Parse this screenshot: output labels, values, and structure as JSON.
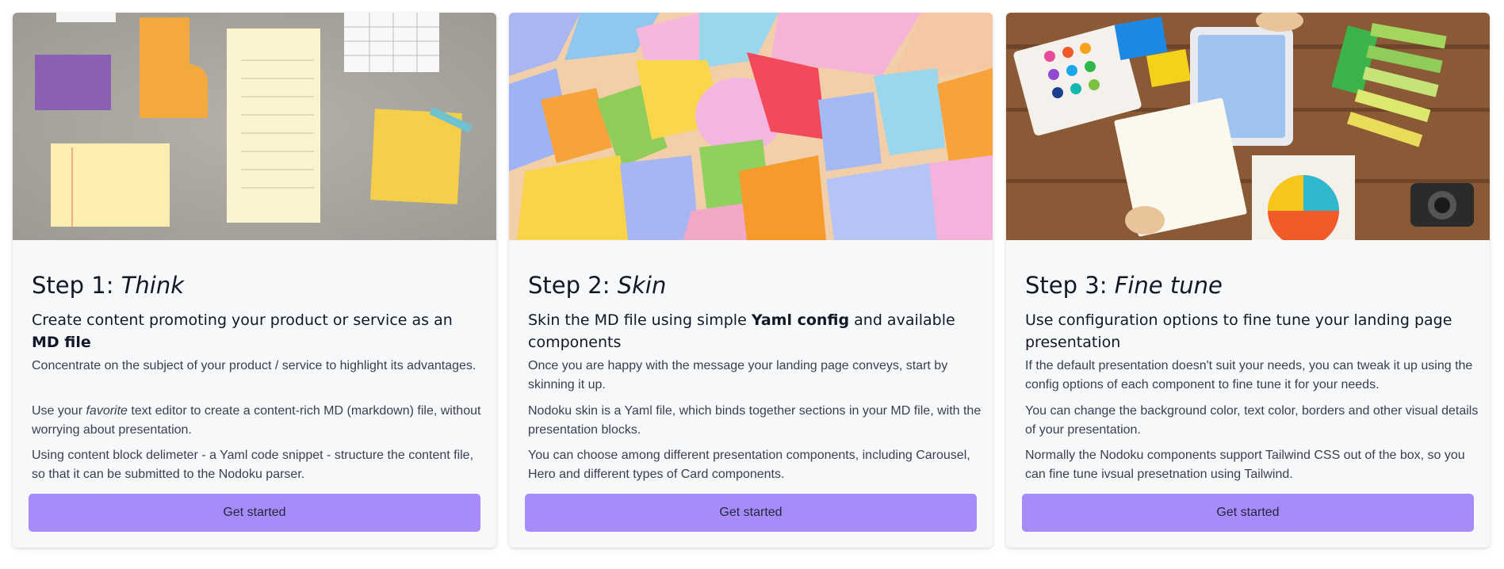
{
  "cards": [
    {
      "step_prefix": "Step 1: ",
      "step_name": "Think",
      "heading_before": "Create content promoting your product or service as an ",
      "heading_bold": "MD file",
      "heading_after": "",
      "p1": "Concentrate on the subject of your product / service to highlight its advantages.",
      "p2_before": "Use your ",
      "p2_em": "favorite",
      "p2_after": " text editor to create a content-rich MD (markdown) file, without worrying about presentation.",
      "p3": "Using content block delimeter - a Yaml code snippet - structure the content file, so that it can be submitted to the Nodoku parser.",
      "button": "Get started"
    },
    {
      "step_prefix": "Step 2: ",
      "step_name": "Skin",
      "heading_before": "Skin the MD file using simple ",
      "heading_bold": "Yaml config",
      "heading_after": " and available components",
      "p1": "Once you are happy with the message your landing page conveys, start by skinning it up.",
      "p2": "Nodoku skin is a Yaml file, which binds together sections in your MD file, with the presentation blocks.",
      "p3": "You can choose among different presentation components, including Carousel, Hero and different types of Card components.",
      "button": "Get started"
    },
    {
      "step_prefix": "Step 3: ",
      "step_name": "Fine tune",
      "heading_before": "Use configuration options to fine tune your landing page presentation",
      "p1": "If the default presentation doesn't suit your needs, you can tweak it up using the config options of each component to fine tune it for your needs.",
      "p2": "You can change the background color, text color, borders and other visual details of your presentation.",
      "p3": "Normally the Nodoku components support Tailwind CSS out of the box, so you can fine tune ivsual presetnation using Tailwind.",
      "button": "Get started"
    }
  ],
  "colors": {
    "button": "#a78bfa",
    "card_bg": "#f7f8fa",
    "text": "#1f2937"
  },
  "images": [
    "sticky-notes-photo",
    "colorful-blocks-photo",
    "design-desk-photo"
  ]
}
